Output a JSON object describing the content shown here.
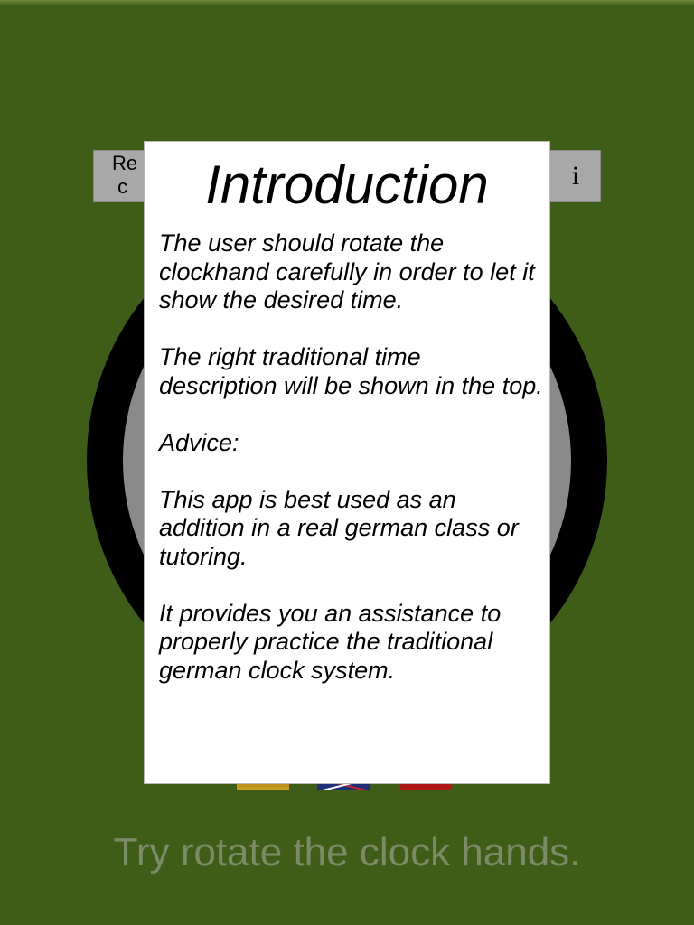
{
  "background_color": "#3e5e17",
  "toolbar": {
    "left_button_label": "Re\n c",
    "info_button_label": "i"
  },
  "clock": {
    "ring_color": "#000000",
    "face_color": "#8a8a8a"
  },
  "languages": {
    "items": [
      "german-flag",
      "uk-flag",
      "third-flag"
    ]
  },
  "hint_text": "Try rotate the clock hands.",
  "dialog": {
    "title": "Introduction",
    "paragraphs": [
      "The user should rotate the clockhand carefully in order to let it show the desired time.",
      "The right traditional time description will be shown in the top.",
      "Advice:",
      "This app is best used as an addition in a real german class or tutoring.",
      "It provides you an assistance to properly practice the traditional german clock system."
    ]
  }
}
